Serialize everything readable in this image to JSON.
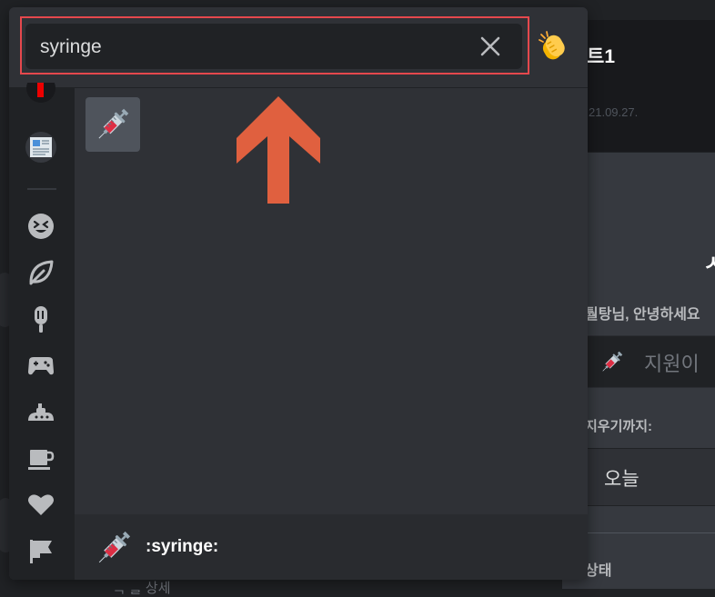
{
  "background": {
    "channel_title_fragment": "트1",
    "date_fragment": "21.09.27.",
    "heading_fragment": "ㅅ",
    "greeting": "퉐탕님, 안녕하세요",
    "status_input_placeholder": "지원이",
    "clear_after_label": "지우기까지:",
    "clear_after_value": "오늘",
    "status_label": "상태",
    "bottom_text": "ᆨ ᆯ 상세"
  },
  "picker": {
    "search": {
      "value": "syringe",
      "clear_icon": "close-icon"
    },
    "skin_tone_button_icon": "clapping-hands-icon",
    "categories": [
      {
        "name": "recent",
        "icon": "red-bar-icon"
      },
      {
        "name": "server",
        "icon": "newspaper-icon"
      },
      {
        "name": "people",
        "icon": "smiley-icon"
      },
      {
        "name": "nature",
        "icon": "leaf-icon"
      },
      {
        "name": "food",
        "icon": "popsicle-icon"
      },
      {
        "name": "activities",
        "icon": "gamepad-icon"
      },
      {
        "name": "travel",
        "icon": "submarine-icon"
      },
      {
        "name": "objects",
        "icon": "coffee-icon"
      },
      {
        "name": "symbols",
        "icon": "heart-icon"
      },
      {
        "name": "flags",
        "icon": "flag-icon"
      }
    ],
    "results": [
      {
        "emoji": "syringe",
        "icon": "syringe-icon"
      }
    ],
    "preview": {
      "name": ":syringe:",
      "icon": "syringe-icon"
    }
  },
  "colors": {
    "highlight_border": "#e5484d",
    "arrow": "#e0603f",
    "picker_bg": "#2f3136",
    "sidebar_bg": "#202225"
  }
}
